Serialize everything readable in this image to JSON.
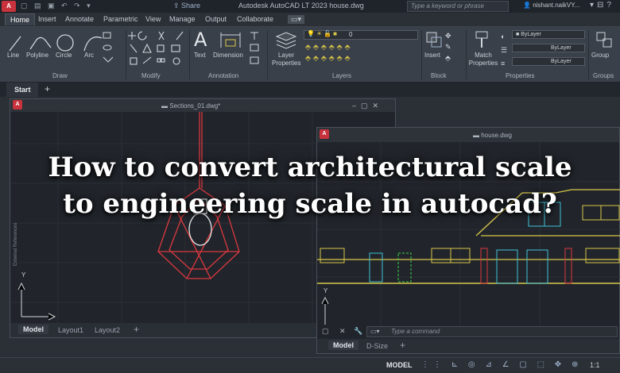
{
  "titlebar": {
    "app_badge": "A",
    "share_label": "Share",
    "window_title": "Autodesk AutoCAD LT 2023    house.dwg",
    "search_placeholder": "Type a keyword or phrase",
    "user_name": "nishant.naikVY..."
  },
  "ribbon_tabs": [
    "Home",
    "Insert",
    "Annotate",
    "Parametric",
    "View",
    "Manage",
    "Output",
    "Collaborate"
  ],
  "ribbon": {
    "draw": {
      "title": "Draw",
      "tools": [
        "Line",
        "Polyline",
        "Circle",
        "Arc"
      ]
    },
    "modify": {
      "title": "Modify"
    },
    "annotation": {
      "title": "Annotation",
      "tools": [
        "Text",
        "Dimension"
      ]
    },
    "layers": {
      "title": "Layers",
      "layer_properties": "Layer Properties",
      "current_layer": "0"
    },
    "block": {
      "title": "Block",
      "insert": "Insert"
    },
    "properties": {
      "title": "Properties",
      "match": "Match Properties",
      "color": "ByLayer",
      "linetype": "ByLayer",
      "lineweight": "ByLayer"
    },
    "groups": {
      "title": "Groups",
      "group": "Group"
    }
  },
  "doc_tabs": {
    "start": "Start",
    "add": "+"
  },
  "window1": {
    "title": "Sections_01.dwg*",
    "side_palette": "External References",
    "layout_tabs": [
      "Model",
      "Layout1",
      "Layout2"
    ],
    "add_tab": "+"
  },
  "window2": {
    "title": "house.dwg",
    "command_placeholder": "Type a command",
    "layout_tabs": [
      "Model",
      "D-Size"
    ],
    "add_tab": "+"
  },
  "statusbar": {
    "model": "MODEL",
    "scale": "1:1"
  },
  "headline": {
    "line1": "How to convert architectural scale",
    "line2": "to engineering scale in autocad?"
  },
  "colors": {
    "accent_red": "#c8323c",
    "cad_red": "#d9383e",
    "cad_yellow": "#d8c64a",
    "cad_cyan": "#3fc1d8",
    "cad_green": "#3fd24a"
  }
}
